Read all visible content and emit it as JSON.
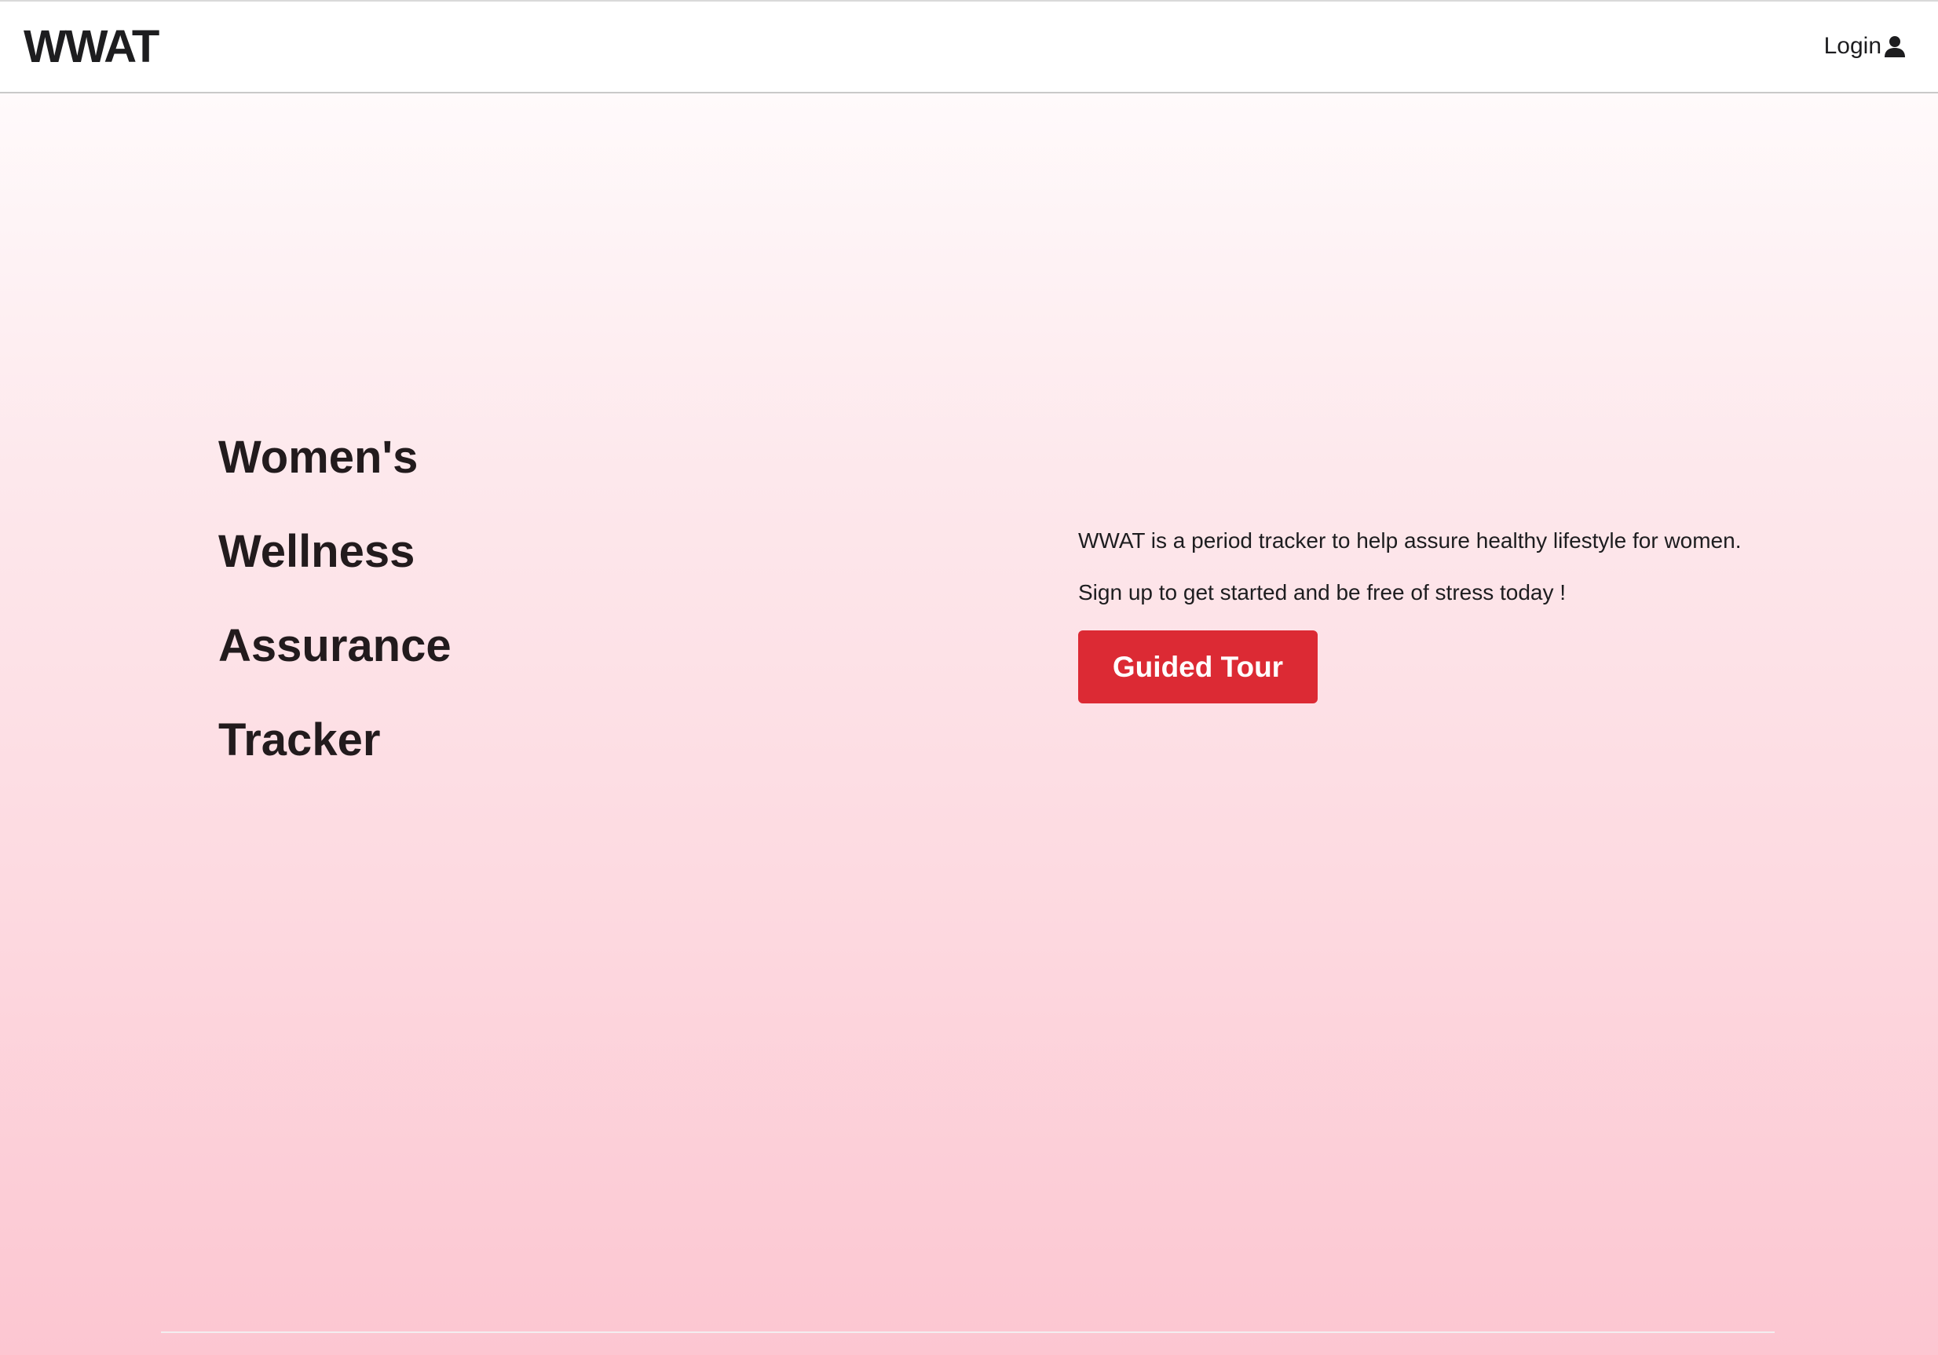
{
  "navbar": {
    "brand": "WWAT",
    "login_label": "Login",
    "login_icon": "user-icon"
  },
  "hero": {
    "words": [
      "Women's",
      "Wellness",
      "Assurance",
      "Tracker"
    ],
    "description": "WWAT is a period tracker to help assure healthy lifestyle for women.",
    "tagline": "Sign up to get started and be free of stress today !",
    "tour_button_label": "Guided Tour"
  },
  "colors": {
    "accent": "#dc2a34",
    "gradient_top": "#fffafb",
    "gradient_bottom": "#fcc6d1",
    "text": "#221b1d"
  }
}
